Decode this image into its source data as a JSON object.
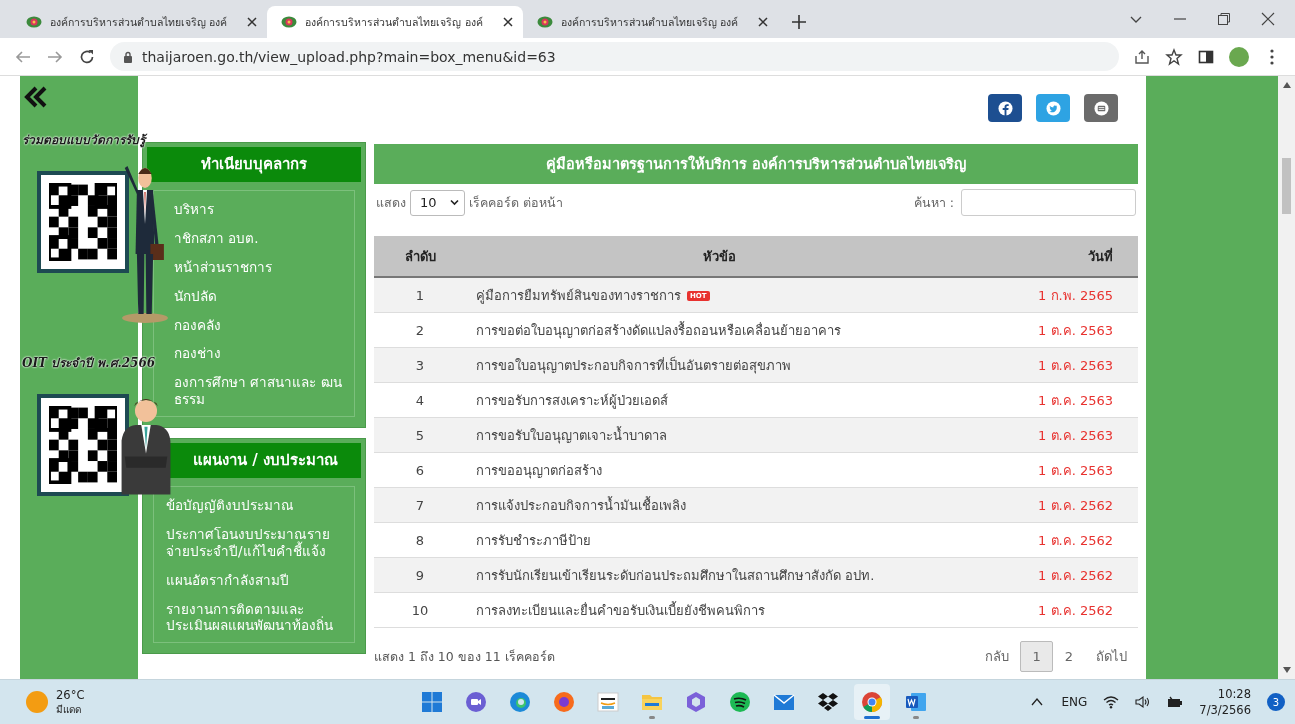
{
  "browser": {
    "tabs": [
      {
        "title": "องค์การบริหารส่วนตำบลไทยเจริญ องค์",
        "selected": false
      },
      {
        "title": "องค์การบริหารส่วนตำบลไทยเจริญ องค์",
        "selected": true
      },
      {
        "title": "องค์การบริหารส่วนตำบลไทยเจริญ องค์",
        "selected": false
      }
    ],
    "url": "thaijaroen.go.th/view_upload.php?main=box_menu&id=63"
  },
  "banner": {
    "headings": [
      "ร่วมตอบแบบวัดการรับรู้",
      "OIT ประจำปี พ.ศ.2566"
    ]
  },
  "menus": [
    {
      "title": "ทำเนียบบุคลากร",
      "items": [
        "บริหาร",
        "าชิกสภา อบต.",
        "หน้าส่วนราชการ",
        "นักปลัด",
        "กองคลัง",
        "กองช่าง",
        "องการศึกษา ศาสนาและ ฒนธรรม"
      ]
    },
    {
      "title": "แผนงาน / งบประมาณ",
      "items": [
        "ข้อบัญญัติงบประมาณ",
        "ประกาศโอนงบประมาณรายจ่ายประจำปี/แก้ไขคำชี้แจ้ง",
        "แผนอัตรากำลังสามปี",
        "รายงานการติดตามและประเมินผลแผนพัฒนาท้องถิ่น"
      ]
    }
  ],
  "share": [
    {
      "kind": "facebook",
      "color": "#1d4f91"
    },
    {
      "kind": "twitter",
      "color": "#2ea3e3"
    },
    {
      "kind": "email",
      "color": "#6b6b6b"
    }
  ],
  "table": {
    "title": "คู่มือหรือมาตรฐานการให้บริการ องค์การบริหารส่วนตำบลไทยเจริญ",
    "show_label": "แสดง",
    "page_size": "10",
    "per_page_label": "เร็คคอร์ด ต่อหน้า",
    "search_label": "ค้นหา :",
    "columns": [
      "ลำดับ",
      "หัวข้อ",
      "วันที่"
    ],
    "rows": [
      {
        "no": "1",
        "subject": "คู่มือการยืมทรัพย์สินของทางราชการ",
        "badge": "HOT",
        "date": "1 ก.พ. 2565"
      },
      {
        "no": "2",
        "subject": "การขอต่อใบอนุญาตก่อสร้างดัดแปลงรื้อถอนหรือเคลื่อนย้ายอาคาร",
        "date": "1 ต.ค. 2563"
      },
      {
        "no": "3",
        "subject": "การขอใบอนุญาตประกอบกิจการที่เป็นอันตรายต่อสุขภาพ",
        "date": "1 ต.ค. 2563"
      },
      {
        "no": "4",
        "subject": "การขอรับการสงเคราะห์ผู้ป่วยเอดส์",
        "date": "1 ต.ค. 2563"
      },
      {
        "no": "5",
        "subject": "การขอรับใบอนุญาตเจาะน้ำบาดาล",
        "date": "1 ต.ค. 2563"
      },
      {
        "no": "6",
        "subject": "การขออนุญาตก่อสร้าง",
        "date": "1 ต.ค. 2563"
      },
      {
        "no": "7",
        "subject": "การแจ้งประกอบกิจการน้ำมันเชื้อเพลิง",
        "date": "1 ต.ค. 2562"
      },
      {
        "no": "8",
        "subject": "การรับชำระภาษีป้าย",
        "date": "1 ต.ค. 2562"
      },
      {
        "no": "9",
        "subject": "การรับนักเรียนเข้าเรียนระดับก่อนประถมศึกษาในสถานศึกษาสังกัด อปท.",
        "date": "1 ต.ค. 2562"
      },
      {
        "no": "10",
        "subject": "การลงทะเบียนและยื่นคำขอรับเงินเบี้ยยังชีพคนพิการ",
        "date": "1 ต.ค. 2562"
      }
    ],
    "info": "แสดง 1 ถึง 10 ของ 11 เร็คคอร์ด",
    "pagination": {
      "prev": "กลับ",
      "pages": [
        {
          "label": "1",
          "selected": true
        },
        {
          "label": "2",
          "selected": false
        }
      ],
      "next": "ถัดไป"
    }
  },
  "taskbar": {
    "temperature": "26°C",
    "weather": "มีแดด",
    "apps": [
      {
        "kind": "windows",
        "open": false,
        "selected": false
      },
      {
        "kind": "video",
        "open": false,
        "selected": false
      },
      {
        "kind": "edge",
        "open": false,
        "selected": false
      },
      {
        "kind": "firefox",
        "open": false,
        "selected": false
      },
      {
        "kind": "amazon",
        "open": false,
        "selected": false
      },
      {
        "kind": "folder",
        "open": true,
        "selected": false
      },
      {
        "kind": "hexagon",
        "open": false,
        "selected": false
      },
      {
        "kind": "spotify",
        "open": false,
        "selected": false
      },
      {
        "kind": "mail",
        "open": false,
        "selected": false
      },
      {
        "kind": "dropbox",
        "open": false,
        "selected": false
      },
      {
        "kind": "chrome",
        "open": true,
        "selected": true
      },
      {
        "kind": "word",
        "open": true,
        "selected": false
      }
    ],
    "language": "ENG",
    "time": "10:28",
    "date": "7/3/2566",
    "notifications": "3"
  }
}
